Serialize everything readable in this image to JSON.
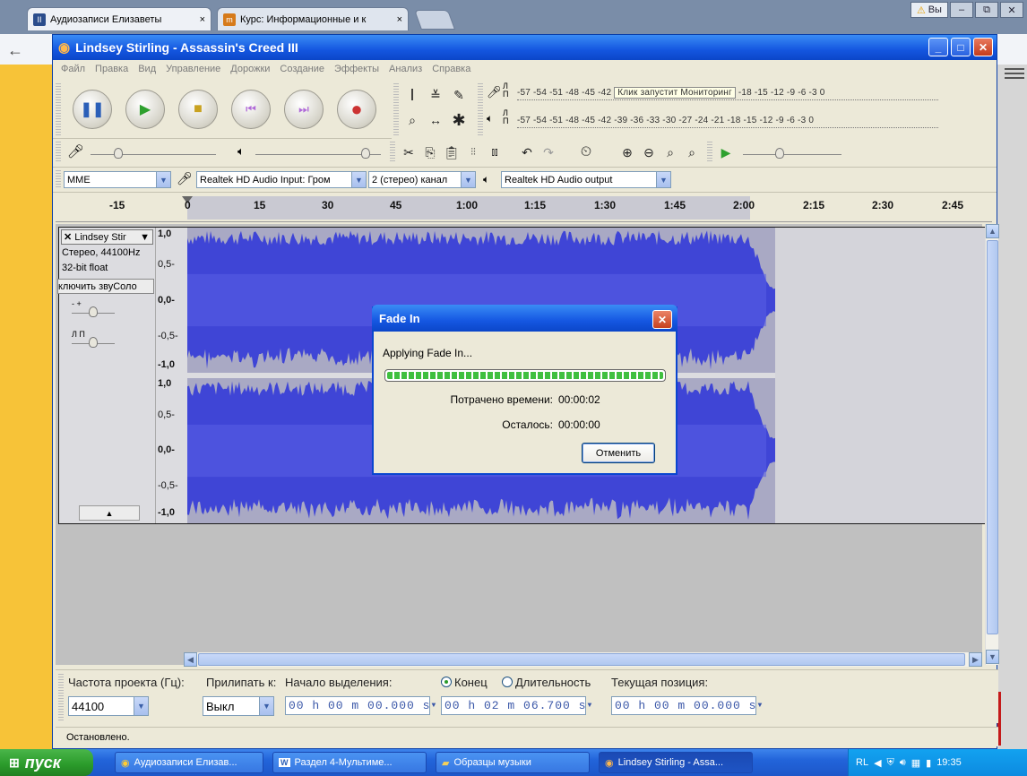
{
  "browser": {
    "tabs": [
      {
        "label": "Аудиозаписи Елизаветы",
        "close": "×"
      },
      {
        "label": "Курс: Информационные и к",
        "close": "×"
      }
    ],
    "warn_label": "Вы",
    "window_controls": [
      "–",
      "⧉",
      "✕"
    ],
    "back": "←"
  },
  "app": {
    "title": "Lindsey Stirling - Assassin's Creed III",
    "menu": [
      "Файл",
      "Правка",
      "Вид",
      "Управление",
      "Дорожки",
      "Создание",
      "Эффекты",
      "Анализ",
      "Справка"
    ],
    "meter_rec": "-57 -54 -51 -48 -45 -42",
    "meter_rec_tip": "Клик запустит Мониторинг",
    "meter_rec_right": "-18 -15 -12  -9  -6  -3  0",
    "meter_play": "-57 -54 -51 -48 -45 -42 -39 -36 -33 -30 -27 -24 -21 -18 -15 -12  -9  -6  -3  0",
    "meter_L": "Л",
    "meter_P": "П",
    "device": {
      "host": "MME",
      "input": "Realtek HD Audio Input: Гром",
      "channels": "2 (стерео) канал",
      "output": "Realtek HD Audio output"
    }
  },
  "ruler": {
    "labels": [
      "-15",
      "0",
      "15",
      "30",
      "45",
      "1:00",
      "1:15",
      "1:30",
      "1:45",
      "2:00",
      "2:15",
      "2:30",
      "2:45"
    ]
  },
  "track": {
    "name": "Lindsey Stir",
    "format": "Стерео, 44100Hz",
    "bits": "32-bit float",
    "mute_solo": "ключить звуСоло",
    "scale": [
      "1,0",
      "0,5-",
      "0,0-",
      "-0,5-",
      "-1,0"
    ],
    "gain_marks": "- +",
    "pan_marks": "Л П"
  },
  "dialog": {
    "title": "Fade In",
    "message": "Applying Fade In...",
    "elapsed_label": "Потрачено времени:",
    "elapsed_value": "00:00:02",
    "remaining_label": "Осталось:",
    "remaining_value": "00:00:00",
    "cancel": "Отменить",
    "progress": 1.0
  },
  "selection": {
    "rate_label": "Частота проекта (Гц):",
    "rate_value": "44100",
    "snap_label": "Прилипать к:",
    "snap_value": "Выкл",
    "start_label": "Начало выделения:",
    "end_label": "Конец",
    "length_label": "Длительность",
    "position_label": "Текущая позиция:",
    "start_value": "00 h 00 m 00.000 s",
    "end_value": "00 h 02 m 06.700 s",
    "position_value": "00 h 00 m 00.000 s"
  },
  "status": "Остановлено.",
  "taskbar": {
    "start": "пуск",
    "tasks": [
      "Аудиозаписи Елизав...",
      "Раздел 4-Мультиме...",
      "Образцы музыки",
      "Lindsey Stirling - Assa..."
    ],
    "tray_lang": "RL",
    "clock": "19:35"
  },
  "colors": {
    "wave": "#3f45d6",
    "wave_bg": "#a9a9c4",
    "xp_blue": "#1456e0"
  }
}
